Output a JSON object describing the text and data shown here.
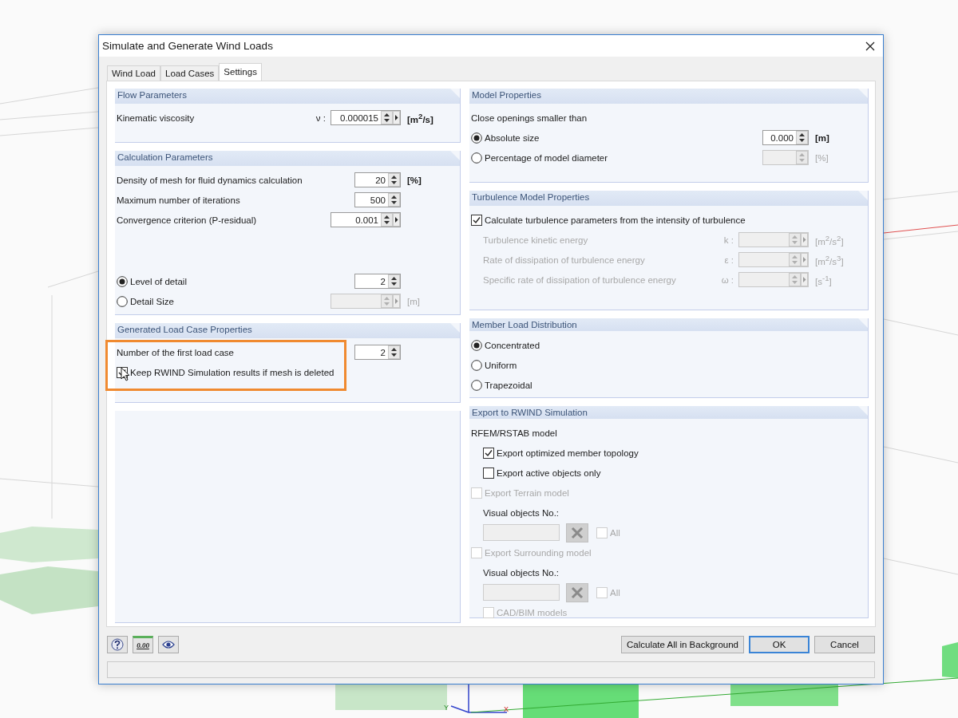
{
  "window": {
    "title": "Simulate and Generate Wind Loads"
  },
  "viewport": {
    "axis_labels": [
      "Y",
      "X"
    ]
  },
  "tabs": [
    {
      "label": "Wind Load",
      "selected": false
    },
    {
      "label": "Load Cases",
      "selected": false
    },
    {
      "label": "Settings",
      "selected": true
    }
  ],
  "left_column": [
    {
      "kind": "group",
      "title": "Flow Parameters",
      "rows": [
        {
          "kind": "spin",
          "label": "Kinematic viscosity",
          "symbol": "ν :",
          "value": "0.000015",
          "more": true,
          "unit": "[m$^{2}$/s]",
          "disabled": false
        }
      ]
    },
    {
      "kind": "group",
      "title": "Calculation Parameters",
      "rows": [
        {
          "kind": "spin",
          "label": "Density of mesh for fluid dynamics calculation",
          "value": "20",
          "more": false,
          "unit": "[%]",
          "disabled": false
        },
        {
          "kind": "spin",
          "label": "Maximum number of iterations",
          "value": "500",
          "more": false,
          "disabled": false
        },
        {
          "kind": "spin",
          "label": "Convergence criterion (P-residual)",
          "value": "0.001",
          "more": true,
          "disabled": false
        },
        {
          "kind": "radio",
          "label": "Level of detail",
          "selected": true,
          "field": {
            "value": "2",
            "more": false,
            "disabled": false
          }
        },
        {
          "kind": "radio",
          "label": "Detail Size",
          "selected": false,
          "field": {
            "more": true,
            "disabled": true
          },
          "unit": "[m]"
        }
      ]
    },
    {
      "kind": "group",
      "title": "Generated Load Case Properties",
      "rows": [
        {
          "kind": "spin",
          "label": "Number of the first load case",
          "value": "2",
          "more": false,
          "disabled": false
        },
        {
          "kind": "check",
          "label": "Keep RWIND Simulation results if mesh is deleted",
          "checked": true,
          "disabled": false,
          "highlighted": true
        }
      ]
    },
    {
      "kind": "empty"
    }
  ],
  "right_column": [
    {
      "kind": "group",
      "title": "Model Properties",
      "rows": [
        {
          "kind": "text",
          "label": "Close openings smaller than"
        },
        {
          "kind": "radio",
          "label": "Absolute size",
          "selected": true,
          "field": {
            "value": "0.000",
            "more": false,
            "disabled": false
          },
          "unit": "[m]"
        },
        {
          "kind": "radio",
          "label": "Percentage of model diameter",
          "selected": false,
          "field": {
            "more": false,
            "disabled": true
          },
          "unit": "[%]"
        }
      ]
    },
    {
      "kind": "group",
      "title": "Turbulence Model Properties",
      "rows": [
        {
          "kind": "check",
          "label": "Calculate turbulence parameters from the intensity of turbulence",
          "checked": true,
          "disabled": false,
          "highlighted": false,
          "children": [
            {
              "kind": "spin",
              "label": "Turbulence kinetic energy",
              "symbol": "k :",
              "more": true,
              "unit": "[m$^{2}$/s$^{2}$]",
              "disabled": true
            },
            {
              "kind": "spin",
              "label": "Rate of dissipation of turbulence energy",
              "symbol": "ε :",
              "more": true,
              "unit": "[m$^{2}$/s$^{3}$]",
              "disabled": true
            },
            {
              "kind": "spin",
              "label": "Specific rate of dissipation of turbulence energy",
              "symbol": "ω :",
              "more": true,
              "unit": "[s$^{-1}$]",
              "disabled": true
            }
          ]
        }
      ]
    },
    {
      "kind": "group",
      "title": "Member Load Distribution",
      "rows": [
        {
          "kind": "radio",
          "label": "Concentrated",
          "selected": true
        },
        {
          "kind": "radio",
          "label": "Uniform",
          "selected": false
        },
        {
          "kind": "radio",
          "label": "Trapezoidal",
          "selected": false
        }
      ]
    },
    {
      "kind": "group",
      "title": "Export to RWIND Simulation",
      "rows": [
        {
          "kind": "text",
          "label": "RFEM/RSTAB model",
          "children": [
            {
              "kind": "check",
              "label": "Export optimized member topology",
              "checked": true,
              "disabled": false,
              "highlighted": false
            },
            {
              "kind": "check",
              "label": "Export active objects only",
              "checked": false,
              "disabled": false,
              "highlighted": false
            }
          ]
        },
        {
          "kind": "check",
          "label": "Export Terrain model",
          "checked": false,
          "disabled": true,
          "highlighted": false,
          "children": [
            {
              "kind": "text",
              "label": "Visual objects No.:"
            },
            {
              "kind": "picker",
              "all_label": "All",
              "all_checked": false,
              "disabled": true
            }
          ]
        },
        {
          "kind": "check",
          "label": "Export Surrounding model",
          "checked": false,
          "disabled": true,
          "highlighted": false,
          "children": [
            {
              "kind": "text",
              "label": "Visual objects No.:"
            },
            {
              "kind": "picker",
              "all_label": "All",
              "all_checked": false,
              "disabled": true
            },
            {
              "kind": "check",
              "label": "CAD/BIM models",
              "checked": false,
              "disabled": true,
              "highlighted": false
            }
          ]
        }
      ]
    }
  ],
  "tools": [
    {
      "kind": "help"
    },
    {
      "kind": "decimals",
      "label": "0.00"
    },
    {
      "kind": "view"
    }
  ],
  "buttons": [
    {
      "label": "Calculate All in Background",
      "default": false
    },
    {
      "label": "OK",
      "default": true
    },
    {
      "label": "Cancel",
      "default": false
    }
  ]
}
